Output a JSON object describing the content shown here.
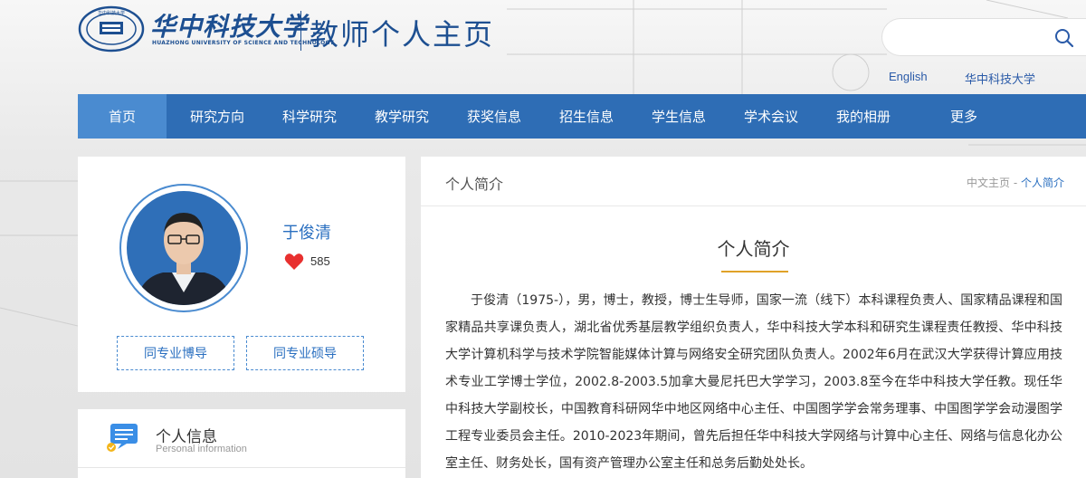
{
  "header": {
    "university_name": "华中科技大学",
    "university_name_en": "HUAZHONG UNIVERSITY OF SCIENCE AND TECHNOLOGY",
    "site_title": "教师个人主页",
    "search": {
      "value": "",
      "placeholder": ""
    },
    "links": {
      "english": "English",
      "university": "华中科技大学"
    }
  },
  "nav": {
    "items": [
      {
        "label": "首页",
        "active": true
      },
      {
        "label": "研究方向"
      },
      {
        "label": "科学研究"
      },
      {
        "label": "教学研究"
      },
      {
        "label": "获奖信息"
      },
      {
        "label": "招生信息"
      },
      {
        "label": "学生信息"
      },
      {
        "label": "学术会议"
      },
      {
        "label": "我的相册"
      },
      {
        "label": "更多"
      }
    ]
  },
  "profile": {
    "name": "于俊清",
    "likes": "585",
    "buttons": {
      "peer_phd": "同专业博导",
      "peer_ms": "同专业硕导"
    }
  },
  "info_card": {
    "title": "个人信息",
    "subtitle": "Personal information"
  },
  "main": {
    "panel_title": "个人简介",
    "breadcrumb": {
      "home": "中文主页",
      "separator": "-",
      "current": "个人简介"
    },
    "section_title": "个人简介",
    "bio": "于俊清（1975-），男，博士，教授，博士生导师，国家一流（线下）本科课程负责人、国家精品课程和国家精品共享课负责人，湖北省优秀基层教学组织负责人，华中科技大学本科和研究生课程责任教授、华中科技大学计算机科学与技术学院智能媒体计算与网络安全研究团队负责人。2002年6月在武汉大学获得计算应用技术专业工学博士学位，2002.8-2003.5加拿大曼尼托巴大学学习，2003.8至今在华中科技大学任教。现任华中科技大学副校长，中国教育科研网华中地区网络中心主任、中国图学学会常务理事、中国图学学会动漫图学工程专业委员会主任。2010-2023年期间，曾先后担任华中科技大学网络与计算中心主任、网络与信息化办公室主任、财务处长，国有资产管理办公室主任和总务后勤处处长。"
  },
  "colors": {
    "brand_blue": "#1d4f91",
    "nav_blue": "#2e6db5",
    "nav_active": "#4a8bd0",
    "accent_gold": "#e0a228",
    "heart_red": "#e8302f"
  }
}
